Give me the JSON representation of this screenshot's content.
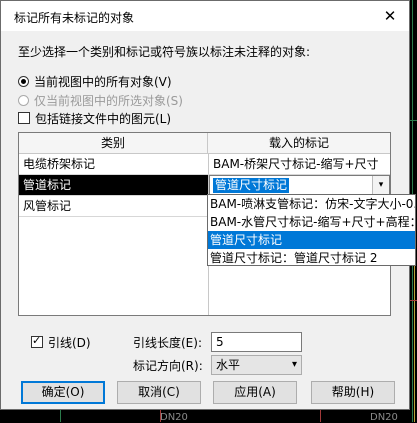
{
  "dialog": {
    "title": "标记所有未标记的对象",
    "close_glyph": "✕",
    "prompt": "至少选择一个类别和标记或符号族以标注未注释的对象:"
  },
  "scope_options": [
    {
      "label": "当前视图中的所有对象(V)",
      "checked": true,
      "enabled": true
    },
    {
      "label": "仅当前视图中的所选对象(S)",
      "checked": false,
      "enabled": false
    }
  ],
  "include_linked": {
    "label": "包括链接文件中的图元(L)",
    "checked": false
  },
  "table": {
    "headers": [
      "类别",
      "载入的标记"
    ],
    "rows": [
      {
        "category": "电缆桥架标记",
        "tag": "BAM-桥架尺寸标记-缩写+尺寸"
      },
      {
        "category": "管道标记",
        "tag": "管道尺寸标记",
        "selected": true
      },
      {
        "category": "风管标记",
        "tag": ""
      }
    ],
    "combo_arrow": "▾"
  },
  "dropdown_options": [
    {
      "label": "BAM-喷淋支管标记：仿宋-文字大小-0.",
      "highlighted": false
    },
    {
      "label": "BAM-水管尺寸标记-缩写+尺寸+高程：",
      "highlighted": false
    },
    {
      "label": "管道尺寸标记",
      "highlighted": true
    },
    {
      "label": "管道尺寸标记：管道尺寸标记 2",
      "highlighted": false
    }
  ],
  "leader": {
    "label": "引线(D)",
    "checked": true
  },
  "leader_length": {
    "label": "引线长度(E):",
    "value": "5"
  },
  "tag_orientation": {
    "label": "标记方向(R):",
    "value": "水平",
    "arrow": "▾"
  },
  "buttons": {
    "ok": "确定(O)",
    "cancel": "取消(C)",
    "apply": "应用(A)",
    "help": "帮助(H)"
  },
  "background_text": [
    "DN20",
    "DN20"
  ]
}
